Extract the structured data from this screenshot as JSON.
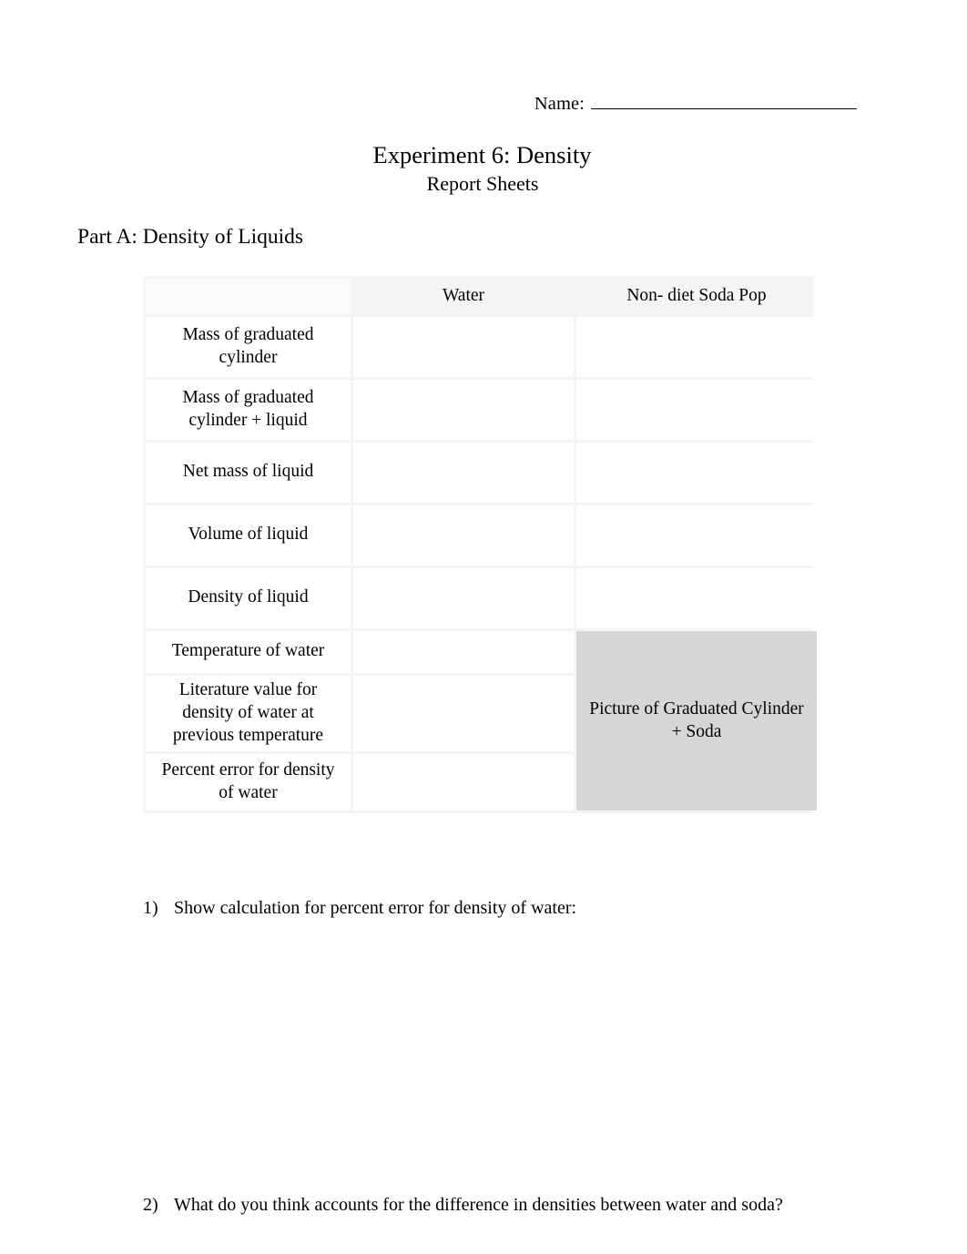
{
  "header": {
    "name_label": "Name:",
    "name_value": "",
    "title": "Experiment 6: Density",
    "subtitle": "Report Sheets"
  },
  "part_a": {
    "heading": "Part A: Density of Liquids",
    "table": {
      "columns": [
        "",
        "Water",
        "Non- diet Soda Pop"
      ],
      "rows": [
        {
          "label": "Mass of graduated cylinder",
          "water": "",
          "soda": ""
        },
        {
          "label": "Mass of graduated cylinder + liquid",
          "water": "",
          "soda": ""
        },
        {
          "label": "Net mass of liquid",
          "water": "",
          "soda": ""
        },
        {
          "label": "Volume of liquid",
          "water": "",
          "soda": ""
        },
        {
          "label": "Density of liquid",
          "water": "",
          "soda": ""
        },
        {
          "label": "Temperature of water",
          "water": ""
        },
        {
          "label": "Literature value for density of water at previous temperature",
          "water": ""
        },
        {
          "label": "Percent error for density of water",
          "water": ""
        }
      ],
      "picture_cell": "Picture of Graduated Cylinder + Soda",
      "picture_cell_bg": "#d6d6d6"
    }
  },
  "questions": [
    {
      "number": "1)",
      "text": "Show calculation for percent error for density of water:"
    },
    {
      "number": "2)",
      "text": "What do you think accounts for the difference in densities between water and soda?"
    }
  ]
}
